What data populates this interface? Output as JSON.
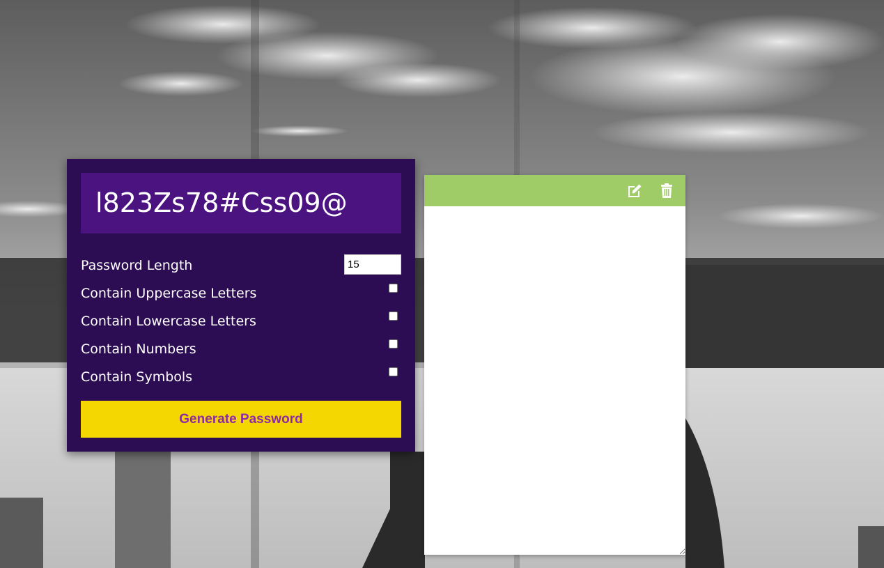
{
  "background": {
    "description_icon": "black-and-white-lakeside-photo"
  },
  "generator": {
    "result": "l823Zs78#Css09@",
    "length_label": "Password Length",
    "length_value": "15",
    "options": [
      {
        "label": "Contain Uppercase Letters",
        "checked": false
      },
      {
        "label": "Contain Lowercase Letters",
        "checked": false
      },
      {
        "label": "Contain Numbers",
        "checked": false
      },
      {
        "label": "Contain Symbols",
        "checked": false
      }
    ],
    "button_label": "Generate Password",
    "colors": {
      "card": "#2c0c52",
      "result_bg": "#4b1380",
      "button_bg": "#f4d700",
      "button_text": "#8e2aa3"
    }
  },
  "note": {
    "header_color": "#9fcc66",
    "icons": [
      "edit-icon",
      "trash-icon"
    ],
    "text": ""
  }
}
